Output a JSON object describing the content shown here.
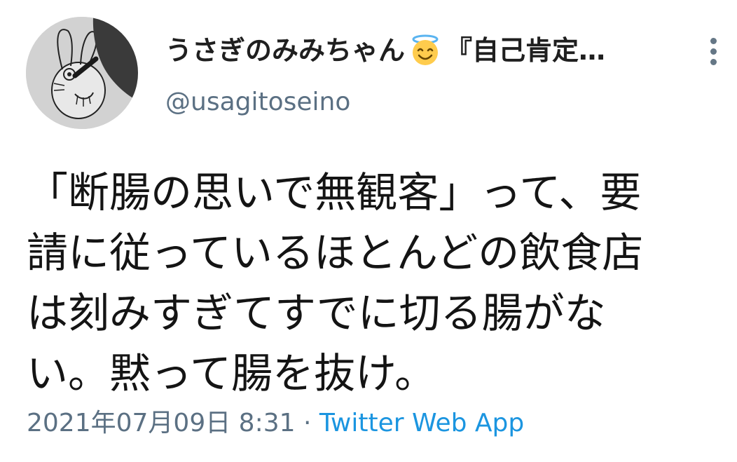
{
  "user": {
    "display_name": "うさぎのみみちゃん",
    "display_name_rest": "『自己肯定…",
    "handle": "@usagitoseino",
    "name_emoji": "smiling-face-with-halo-icon"
  },
  "tweet": {
    "lines": [
      "「断腸の思いで無観客」って、要",
      "請に従っているほとんどの飲食店",
      "は刻みすぎてすでに切る腸がな",
      "い。黙って腸を抜け。"
    ]
  },
  "meta": {
    "timestamp": "2021年07月09日 8:31",
    "separator": " · ",
    "source": "Twitter Web App"
  },
  "icons": {
    "more": "more-vertical-icon",
    "avatar": "rabbit-drawing-avatar"
  },
  "colors": {
    "text": "#141414",
    "secondary": "#5b7083",
    "link": "#1b95e0",
    "halo": "#5ab4f0",
    "emoji_face": "#ffcc4d"
  }
}
